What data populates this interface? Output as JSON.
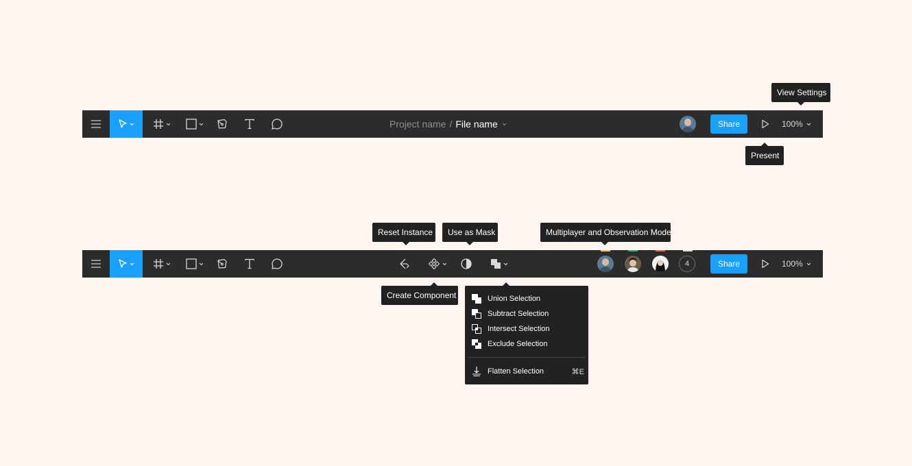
{
  "colors": {
    "background": "#fff6f1",
    "toolbar": "#2c2c2c",
    "accent": "#18a0fb",
    "tooltip": "#222222",
    "presence": [
      "#f5c542",
      "#27ae60",
      "#e8643c",
      "#d9d9d9"
    ]
  },
  "toolbar_top": {
    "tools": [
      "menu-icon",
      "move-icon",
      "frame-icon",
      "rectangle-icon",
      "pen-icon",
      "text-icon",
      "comment-icon"
    ],
    "project_name": "Project name",
    "separator": "/",
    "file_name": "File name",
    "share_label": "Share",
    "zoom": "100%"
  },
  "toolbar_bottom": {
    "tools": [
      "menu-icon",
      "move-icon",
      "frame-icon",
      "rectangle-icon",
      "pen-icon",
      "text-icon",
      "comment-icon"
    ],
    "center_tools": [
      "reset-instance-icon",
      "component-icon",
      "mask-icon",
      "boolean-icon"
    ],
    "collaborator_count": "4",
    "share_label": "Share",
    "zoom": "100%"
  },
  "tooltips": {
    "view_settings": "View Settings",
    "present": "Present",
    "reset_instance": "Reset Instance",
    "use_as_mask": "Use as Mask",
    "multiplayer": "Multiplayer and Observation Mode",
    "create_component": "Create Component"
  },
  "boolean_menu": {
    "items": [
      {
        "label": "Union Selection",
        "icon": "union-icon"
      },
      {
        "label": "Subtract Selection",
        "icon": "subtract-icon"
      },
      {
        "label": "Intersect Selection",
        "icon": "intersect-icon"
      },
      {
        "label": "Exclude Selection",
        "icon": "exclude-icon"
      }
    ],
    "flatten": {
      "label": "Flatten Selection",
      "icon": "flatten-icon",
      "shortcut": "⌘E"
    }
  }
}
